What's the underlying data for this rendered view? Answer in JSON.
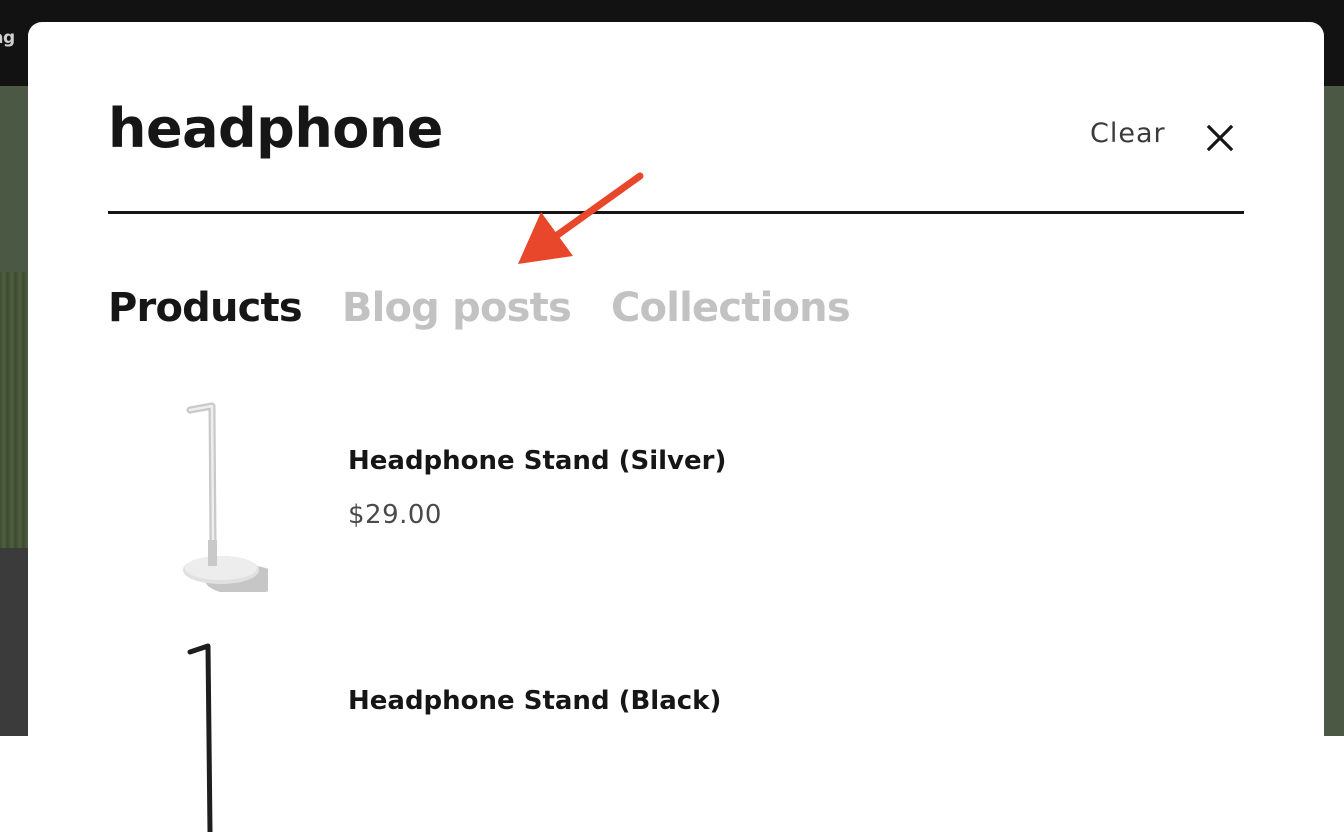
{
  "background": {
    "top_bar_text": "ag"
  },
  "search": {
    "query": "headphone",
    "clear_label": "Clear"
  },
  "tabs": [
    {
      "label": "Products",
      "active": true
    },
    {
      "label": "Blog posts",
      "active": false
    },
    {
      "label": "Collections",
      "active": false
    }
  ],
  "results": [
    {
      "title": "Headphone Stand (Silver)",
      "price": "$29.00",
      "image": "silver-headphone-stand"
    },
    {
      "title": "Headphone Stand (Black)",
      "price": "",
      "image": "black-headphone-stand"
    }
  ],
  "colors": {
    "accent_arrow": "#e8472b",
    "text_primary": "#161616",
    "tab_inactive": "#c2c2c2"
  }
}
